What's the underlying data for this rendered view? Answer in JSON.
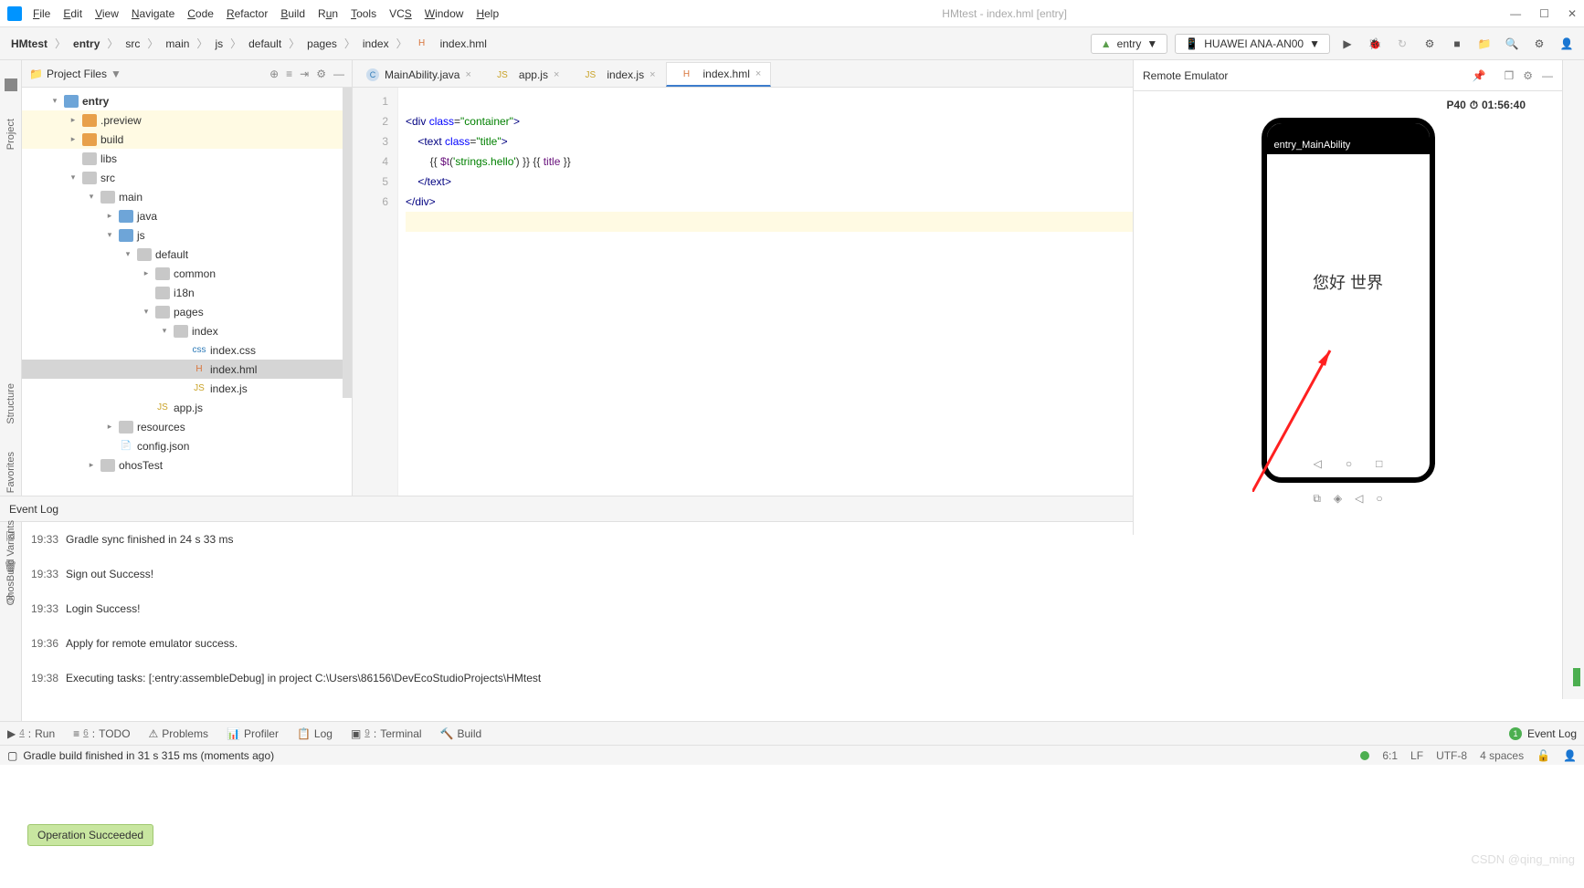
{
  "window": {
    "title": "HMtest - index.hml [entry]"
  },
  "menu": [
    "File",
    "Edit",
    "View",
    "Navigate",
    "Code",
    "Refactor",
    "Build",
    "Run",
    "Tools",
    "VCS",
    "Window",
    "Help"
  ],
  "breadcrumbs": [
    "HMtest",
    "entry",
    "src",
    "main",
    "js",
    "default",
    "pages",
    "index",
    "index.hml"
  ],
  "toolbar": {
    "config": "entry",
    "device": "HUAWEI ANA-AN00"
  },
  "project": {
    "title": "Project Files",
    "tree": {
      "root": "entry",
      "preview": ".preview",
      "build": "build",
      "libs": "libs",
      "src": "src",
      "main": "main",
      "java": "java",
      "js": "js",
      "default": "default",
      "common": "common",
      "i18n": "i18n",
      "pages": "pages",
      "index": "index",
      "indexcss": "index.css",
      "indexhml": "index.hml",
      "indexjs": "index.js",
      "appjs": "app.js",
      "resources": "resources",
      "configjson": "config.json",
      "ohostest": "ohosTest"
    }
  },
  "tabs": [
    {
      "label": "MainAbility.java",
      "icon": "C"
    },
    {
      "label": "app.js",
      "icon": "JS"
    },
    {
      "label": "index.js",
      "icon": "JS"
    },
    {
      "label": "index.hml",
      "icon": "H"
    }
  ],
  "code": {
    "lines": [
      "1",
      "2",
      "3",
      "4",
      "5",
      "6"
    ],
    "l1a": "<div ",
    "l1b": "class",
    "l1c": "=",
    "l1d": "\"container\"",
    "l1e": ">",
    "l2a": "    <text ",
    "l2b": "class",
    "l2c": "=",
    "l2d": "\"title\"",
    "l2e": ">",
    "l3a": "        {{ ",
    "l3b": "$t",
    "l3c": "(",
    "l3d": "'strings.hello'",
    "l3e": ") }} {{ ",
    "l3f": "title",
    "l3g": " }}",
    "l4": "    </text>",
    "l5": "</div>"
  },
  "emulator": {
    "title": "Remote Emulator",
    "device": "P40",
    "timer": "01:56:40",
    "appbar": "entry_MainAbility",
    "hello": "您好 世界"
  },
  "eventlog": {
    "title": "Event Log",
    "entries": [
      {
        "t": "19:33",
        "m": "Gradle sync finished in 24 s 33 ms"
      },
      {
        "t": "19:33",
        "m": "Sign out Success!"
      },
      {
        "t": "19:33",
        "m": "Login Success!"
      },
      {
        "t": "19:36",
        "m": "Apply for remote emulator success."
      },
      {
        "t": "19:38",
        "m": "Executing tasks: [:entry:assembleDebug] in project C:\\Users\\86156\\DevEcoStudioProjects\\HMtest"
      }
    ]
  },
  "toast": "Operation Succeeded",
  "bottomTabs": {
    "run": "Run",
    "todo": "TODO",
    "problems": "Problems",
    "profiler": "Profiler",
    "log": "Log",
    "terminal": "Terminal",
    "build": "Build",
    "eventlog": "Event Log",
    "n4": "4",
    "n6": "6",
    "n9": "9"
  },
  "status": {
    "msg": "Gradle build finished in 31 s 315 ms (moments ago)",
    "pos": "6:1",
    "lf": "LF",
    "enc": "UTF-8",
    "indent": "4 spaces"
  },
  "sideTabs": {
    "project": "Project",
    "structure": "Structure",
    "favorites": "Favorites",
    "variants": "OhosBuild Variants"
  },
  "watermark": "CSDN @qing_ming"
}
